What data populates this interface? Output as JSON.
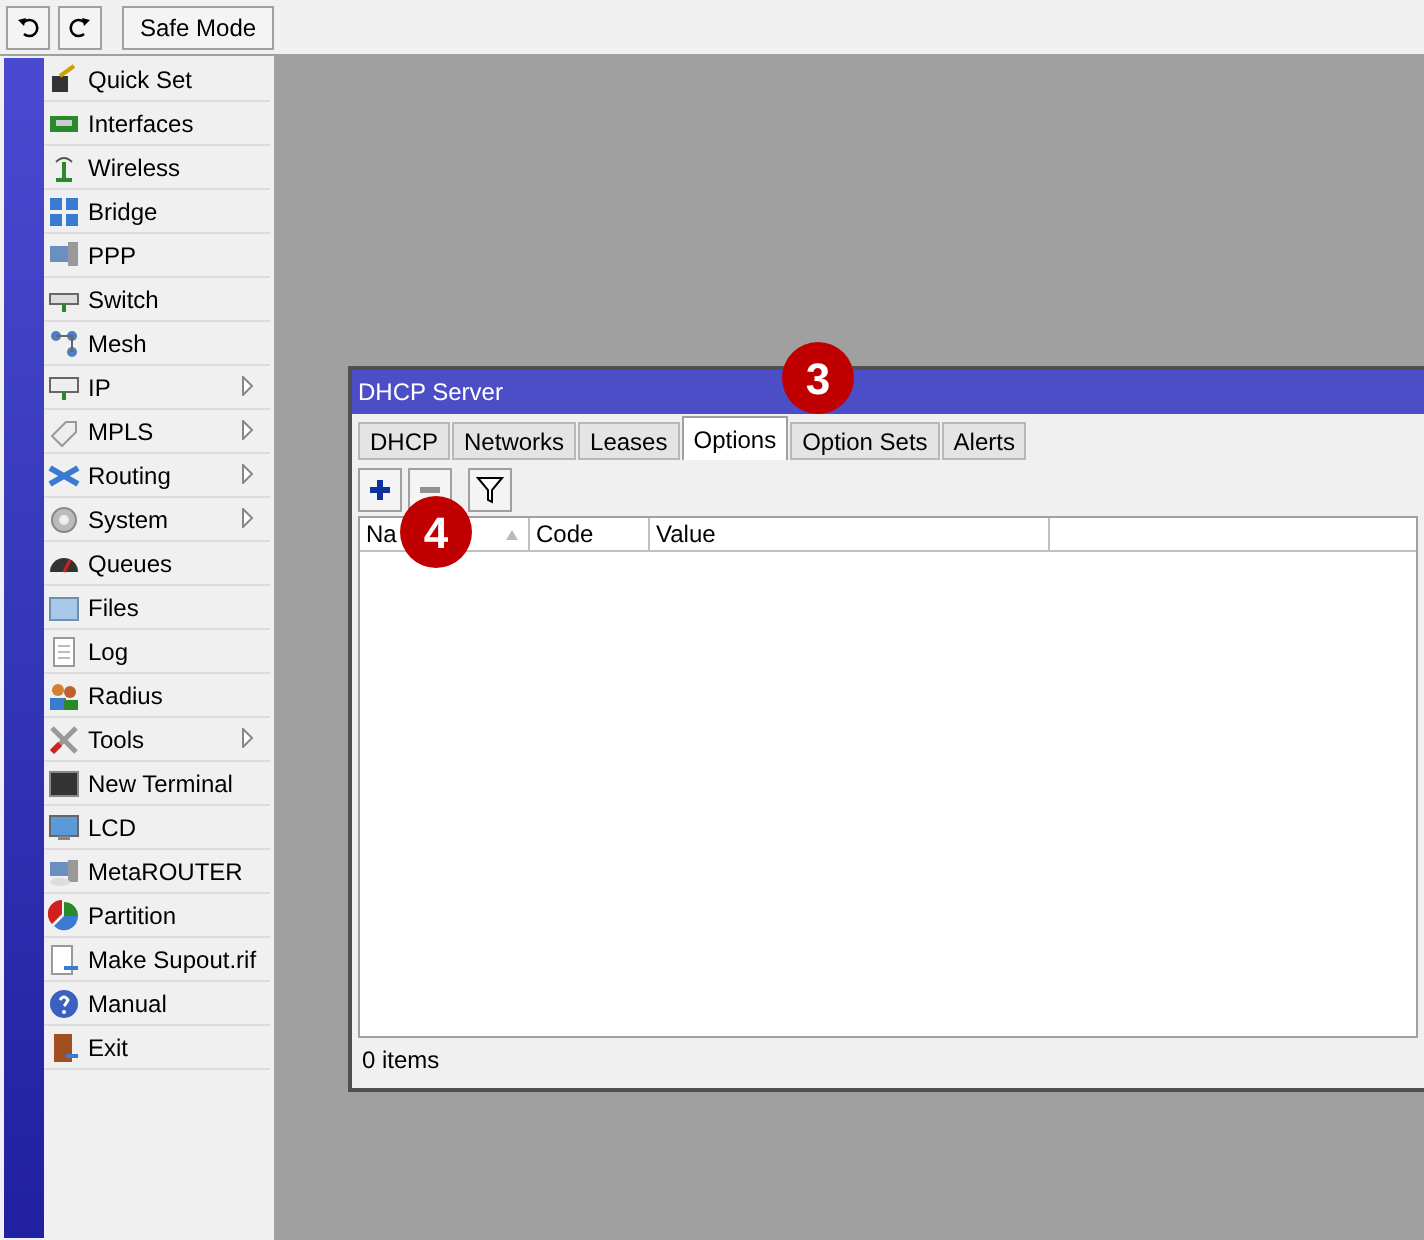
{
  "toolbar": {
    "buttons": [
      {
        "kind": "undo"
      },
      {
        "kind": "redo"
      },
      {
        "kind": "text",
        "label": "Safe Mode"
      }
    ]
  },
  "sidebar": {
    "items": [
      {
        "label": "Quick Set",
        "submenu": false
      },
      {
        "label": "Interfaces",
        "submenu": false
      },
      {
        "label": "Wireless",
        "submenu": false
      },
      {
        "label": "Bridge",
        "submenu": false
      },
      {
        "label": "PPP",
        "submenu": false
      },
      {
        "label": "Switch",
        "submenu": false
      },
      {
        "label": "Mesh",
        "submenu": false
      },
      {
        "label": "IP",
        "submenu": true
      },
      {
        "label": "MPLS",
        "submenu": true
      },
      {
        "label": "Routing",
        "submenu": true
      },
      {
        "label": "System",
        "submenu": true
      },
      {
        "label": "Queues",
        "submenu": false
      },
      {
        "label": "Files",
        "submenu": false
      },
      {
        "label": "Log",
        "submenu": false
      },
      {
        "label": "Radius",
        "submenu": false
      },
      {
        "label": "Tools",
        "submenu": true
      },
      {
        "label": "New Terminal",
        "submenu": false
      },
      {
        "label": "LCD",
        "submenu": false
      },
      {
        "label": "MetaROUTER",
        "submenu": false
      },
      {
        "label": "Partition",
        "submenu": false
      },
      {
        "label": "Make Supout.rif",
        "submenu": false
      },
      {
        "label": "Manual",
        "submenu": false
      },
      {
        "label": "Exit",
        "submenu": false
      }
    ]
  },
  "window": {
    "title": "DHCP Server",
    "tabs": [
      {
        "label": "DHCP",
        "selected": false
      },
      {
        "label": "Networks",
        "selected": false
      },
      {
        "label": "Leases",
        "selected": false
      },
      {
        "label": "Options",
        "selected": true
      },
      {
        "label": "Option Sets",
        "selected": false
      },
      {
        "label": "Alerts",
        "selected": false
      }
    ],
    "table": {
      "columns": [
        "Na",
        "Code",
        "Value"
      ]
    },
    "status_bar": "0 items"
  },
  "callouts": [
    "3",
    "4"
  ]
}
